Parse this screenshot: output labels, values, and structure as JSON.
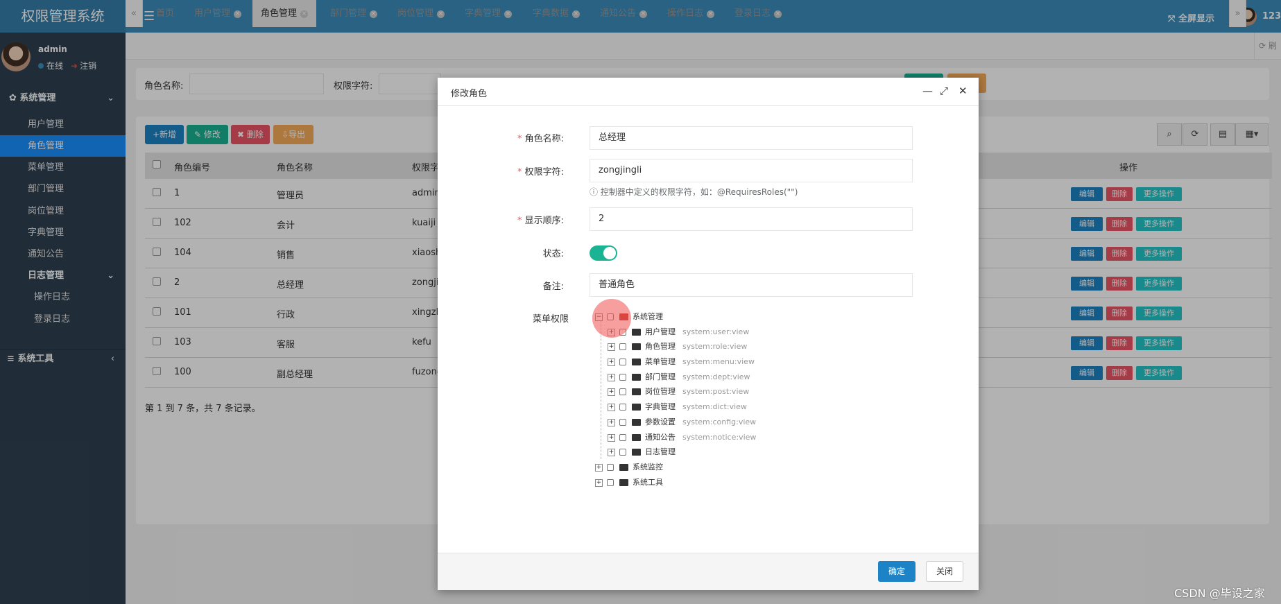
{
  "app": {
    "title": "权限管理系统",
    "fullscreen_label": "全屏显示",
    "top_user": "123"
  },
  "user": {
    "name": "admin",
    "status": "在线",
    "logout": "注销"
  },
  "sidebar": {
    "group_system": "系统管理",
    "items": [
      "用户管理",
      "角色管理",
      "菜单管理",
      "部门管理",
      "岗位管理",
      "字典管理",
      "通知公告"
    ],
    "group_log": "日志管理",
    "log_items": [
      "操作日志",
      "登录日志"
    ],
    "group_tools": "系统工具"
  },
  "tabs": [
    "首页",
    "用户管理",
    "角色管理",
    "部门管理",
    "岗位管理",
    "字典管理",
    "字典数据",
    "通知公告",
    "操作日志",
    "登录日志"
  ],
  "refresh_label": "刷新",
  "search": {
    "role_name_label": "角色名称:",
    "perm_label": "权限字符:"
  },
  "toolbar": {
    "add": "新增",
    "edit": "修改",
    "delete": "删除",
    "export": "导出"
  },
  "table": {
    "headers": {
      "id": "角色编号",
      "name": "角色名称",
      "perm": "权限字",
      "ops": "操作"
    },
    "rows": [
      {
        "id": "1",
        "name": "管理员",
        "perm": "admin"
      },
      {
        "id": "102",
        "name": "会计",
        "perm": "kuaiji"
      },
      {
        "id": "104",
        "name": "销售",
        "perm": "xiaosh"
      },
      {
        "id": "2",
        "name": "总经理",
        "perm": "zongji"
      },
      {
        "id": "101",
        "name": "行政",
        "perm": "xingzh"
      },
      {
        "id": "103",
        "name": "客服",
        "perm": "kefu"
      },
      {
        "id": "100",
        "name": "副总经理",
        "perm": "fuzong"
      }
    ],
    "action_edit": "编辑",
    "action_delete": "删除",
    "action_more": "更多操作",
    "footer": "第 1 到 7 条，共 7 条记录。"
  },
  "dialog": {
    "title": "修改角色",
    "role_name_label": "角色名称:",
    "role_name_value": "总经理",
    "perm_label": "权限字符:",
    "perm_value": "zongjingli",
    "perm_hint": "控制器中定义的权限字符，如：@RequiresRoles(\"\")",
    "order_label": "显示顺序:",
    "order_value": "2",
    "status_label": "状态:",
    "remark_label": "备注:",
    "remark_value": "普通角色",
    "menu_label": "菜单权限",
    "tree": {
      "root": "系统管理",
      "children": [
        {
          "name": "用户管理",
          "perm": "system:user:view"
        },
        {
          "name": "角色管理",
          "perm": "system:role:view"
        },
        {
          "name": "菜单管理",
          "perm": "system:menu:view"
        },
        {
          "name": "部门管理",
          "perm": "system:dept:view"
        },
        {
          "name": "岗位管理",
          "perm": "system:post:view"
        },
        {
          "name": "字典管理",
          "perm": "system:dict:view"
        },
        {
          "name": "参数设置",
          "perm": "system:config:view"
        },
        {
          "name": "通知公告",
          "perm": "system:notice:view"
        },
        {
          "name": "日志管理",
          "perm": ""
        }
      ],
      "others": [
        "系统监控",
        "系统工具"
      ]
    },
    "ok": "确定",
    "close": "关闭"
  },
  "watermark": "CSDN @毕设之家",
  "colors": {
    "topbar": "#3c8dbc",
    "sidebar": "#2f4050",
    "active": "#1890ff",
    "primary": "#1c84c6",
    "success": "#1ab394",
    "danger": "#ed5565",
    "warning": "#f8ac59",
    "info": "#23c6c8"
  }
}
